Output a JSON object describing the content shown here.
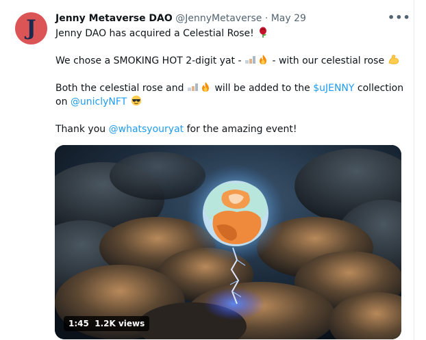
{
  "tweet": {
    "avatar_letter": "J",
    "display_name": "Jenny Metaverse DAO",
    "handle": "@JennyMetaverse",
    "separator": "·",
    "date": "May 29",
    "more_icon": "more-horizontal-icon",
    "line1": "Jenny DAO has acquired a Celestial Rose!",
    "line2_pre": "We chose a SMOKING HOT 2-digit yat -",
    "line2_post": "- with our celestial rose",
    "line3_pre": "Both the celestial rose and",
    "line3_mid": "will be added to the",
    "cashtag": "$uJENNY",
    "line3_post": "collection",
    "line4_pre": "on",
    "mention1": "@uniclyNFT",
    "line5_pre": "Thank you",
    "mention2": "@whatsyouryat",
    "line5_post": "for the amazing event!",
    "emojis": [
      "rose-emoji",
      "yat-emoji",
      "fire-emoji",
      "flexed-biceps-emoji",
      "sunglasses-emoji"
    ]
  },
  "video": {
    "duration": "1:45",
    "views": "1.2K views"
  },
  "colors": {
    "link": "#1d9bf0",
    "text": "#0f1419",
    "secondary": "#536471",
    "avatar_bg": "#dc5556"
  }
}
